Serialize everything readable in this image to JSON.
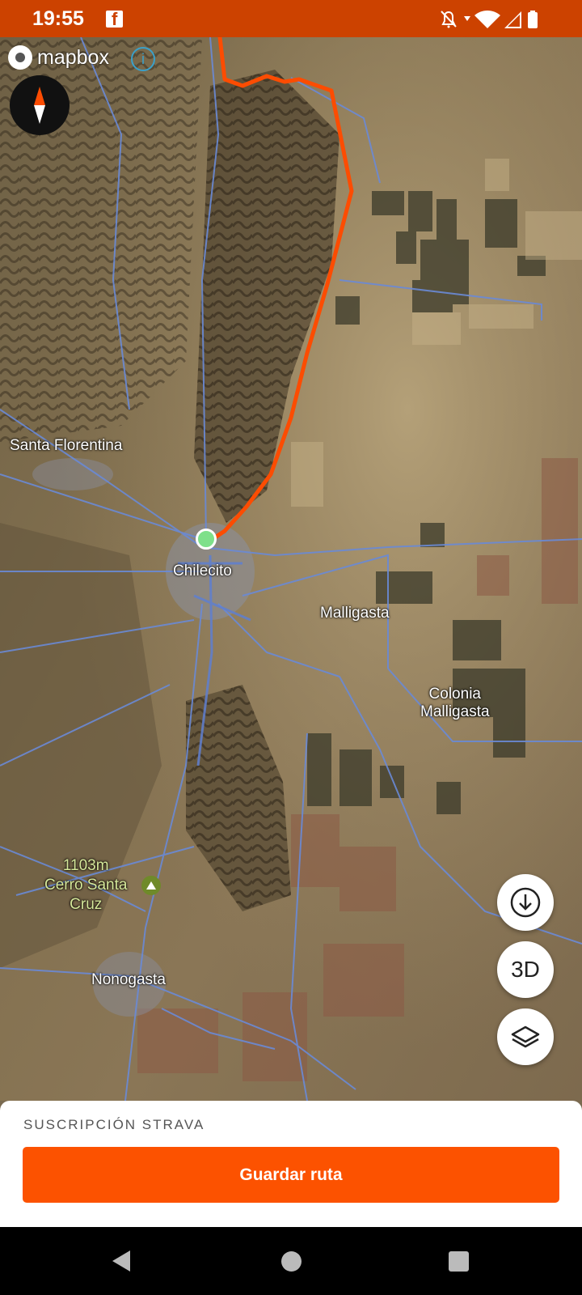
{
  "status_bar": {
    "time": "19:55",
    "notification_icon": "facebook-icon",
    "icons": [
      "notifications-off-icon",
      "wifi-icon",
      "cell-signal-icon",
      "battery-icon"
    ],
    "color": "#cc4200"
  },
  "map": {
    "attribution": "mapbox",
    "labels": {
      "santa_florentina": "Santa Florentina",
      "chilecito": "Chilecito",
      "malligasta": "Malligasta",
      "colonia_malligasta_1": "Colonia",
      "colonia_malligasta_2": "Malligasta",
      "peak_elevation": "1103m",
      "peak_name_1": "Cerro Santa",
      "peak_name_2": "Cruz",
      "nonogasta": "Nonogasta"
    },
    "route_color": "#fc4c02",
    "start_marker_color": "#7ee08a",
    "controls": {
      "download": "download-icon",
      "three_d": "3D",
      "layers": "layers-icon"
    }
  },
  "bottom_sheet": {
    "subscription_label": "SUSCRIPCIÓN STRAVA",
    "save_button": "Guardar ruta",
    "accent": "#fc5200"
  },
  "nav_bar": {
    "buttons": [
      "back-icon",
      "home-icon",
      "recents-icon"
    ]
  }
}
